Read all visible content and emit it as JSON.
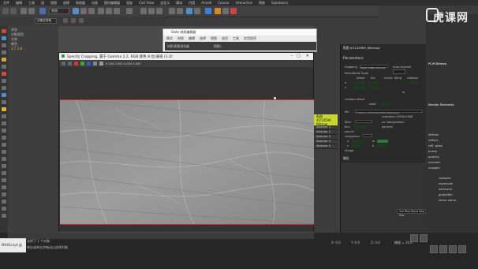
{
  "menubar": {
    "items": [
      "文件",
      "编辑",
      "工具",
      "组",
      "视图",
      "创建",
      "修改器",
      "动画",
      "图形编辑器",
      "渲染",
      "Civil View",
      "自定义",
      "脚本",
      "内容",
      "Arnold",
      "Corona",
      "Interactive",
      "帮助",
      "Substance"
    ]
  },
  "toolbar": {
    "viewport_label": "视图",
    "selection_set": "创建选择集"
  },
  "left_panel": {
    "lines": [
      "状态",
      "对象类型",
      "名称",
      "颜色",
      "1:7.1.0"
    ]
  },
  "editor_window": {
    "title": "Slate 材质编辑器",
    "menu": [
      "模式",
      "材质",
      "编辑",
      "选择",
      "视图",
      "选项",
      "工具",
      "实用程序"
    ],
    "tab_label": "材质/贴图浏览器",
    "view_label": "视图1"
  },
  "image_window": {
    "title": "Specify Cropping, 置于 Gamma 2.2, RGB 颜色 8 位/通道 (1:2)",
    "zoom_readout": "0.000  0.000  0.000  0.000"
  },
  "params": {
    "node_title": "贴图 #2145960 (Bitmap)",
    "section_parameters": "Parameters",
    "mapping_label": "mapping",
    "mapping_value": "Explicit Map Channel",
    "map_channel_label": "map channel",
    "map_channel_value": "1",
    "world_scale_label": "Real-World Scale",
    "cols": [
      "offset",
      "tile",
      "mirror",
      "tiling",
      "rotation"
    ],
    "u_label": "u",
    "v_label": "v",
    "u_offset": "0.0",
    "u_tile": "1.0",
    "v_offset": "0.0",
    "v_tile": "1.0",
    "rotation_value": "0.0",
    "w_label": "w",
    "random_offset_label": "random offset",
    "seed_label": "seed",
    "seed_value": "0",
    "file_label": "file",
    "file_path": "C:\\Users\\...\\Pictures\\marble_texture.jpg",
    "resolution": "resolution 2050x1066",
    "filter_label": "filter",
    "filter_value": "Pyramid",
    "blur_label": "blur",
    "blur_value": "1.0",
    "no_interp_label": "no interpolation",
    "source_label": "source",
    "source_value": "from RGB",
    "gamma_label": "gamma",
    "gamma_value": "Automatic",
    "crop_label": "crop/place",
    "crop_value": "crop",
    "u2": "u",
    "v2": "v",
    "u2_value": "0.0",
    "v2_value": "0.0",
    "w2": "w",
    "h2": "h",
    "w2_value": "0.413",
    "h2_value": "1.0",
    "image_label": "image",
    "view_image_btn": "View Image",
    "output_section": "输出"
  },
  "tag": {
    "name": "贴图 #214596",
    "type": "Bitmap",
    "slots": [
      "Selector 1",
      "Selector 2",
      "Selector 3",
      "Selector 4",
      "Selector 5"
    ]
  },
  "rightpanel": {
    "title": "PCM Bitmap",
    "section": "Render Elements",
    "rows": [
      "diffuse",
      "reflect",
      "refl. gloss",
      "bump",
      "opacity",
      "normals",
      "uvwgen"
    ],
    "right_rows": [
      "rawspec",
      "vspecular",
      "wirecolor",
      "globaltile",
      "share value"
    ],
    "dropdown": "Use Real-World Map Size"
  },
  "bottom": {
    "frame_label": "选择了 1 个对象",
    "status": "单击或单击并拖动以选择对象",
    "mini_label": "MAXScript 迷",
    "coords": [
      "X: 0.0",
      "Y: 0.0",
      "Z: 0.0"
    ],
    "grid": "栅格 = 10.0"
  },
  "logo": {
    "text": "虎课网",
    "badge": "LV"
  },
  "colors": {
    "accent_red": "#c0303a",
    "tag_yellow": "#c9d62c",
    "spinner_green": "#2c7a39",
    "panel_dark": "#2a2a2a"
  }
}
